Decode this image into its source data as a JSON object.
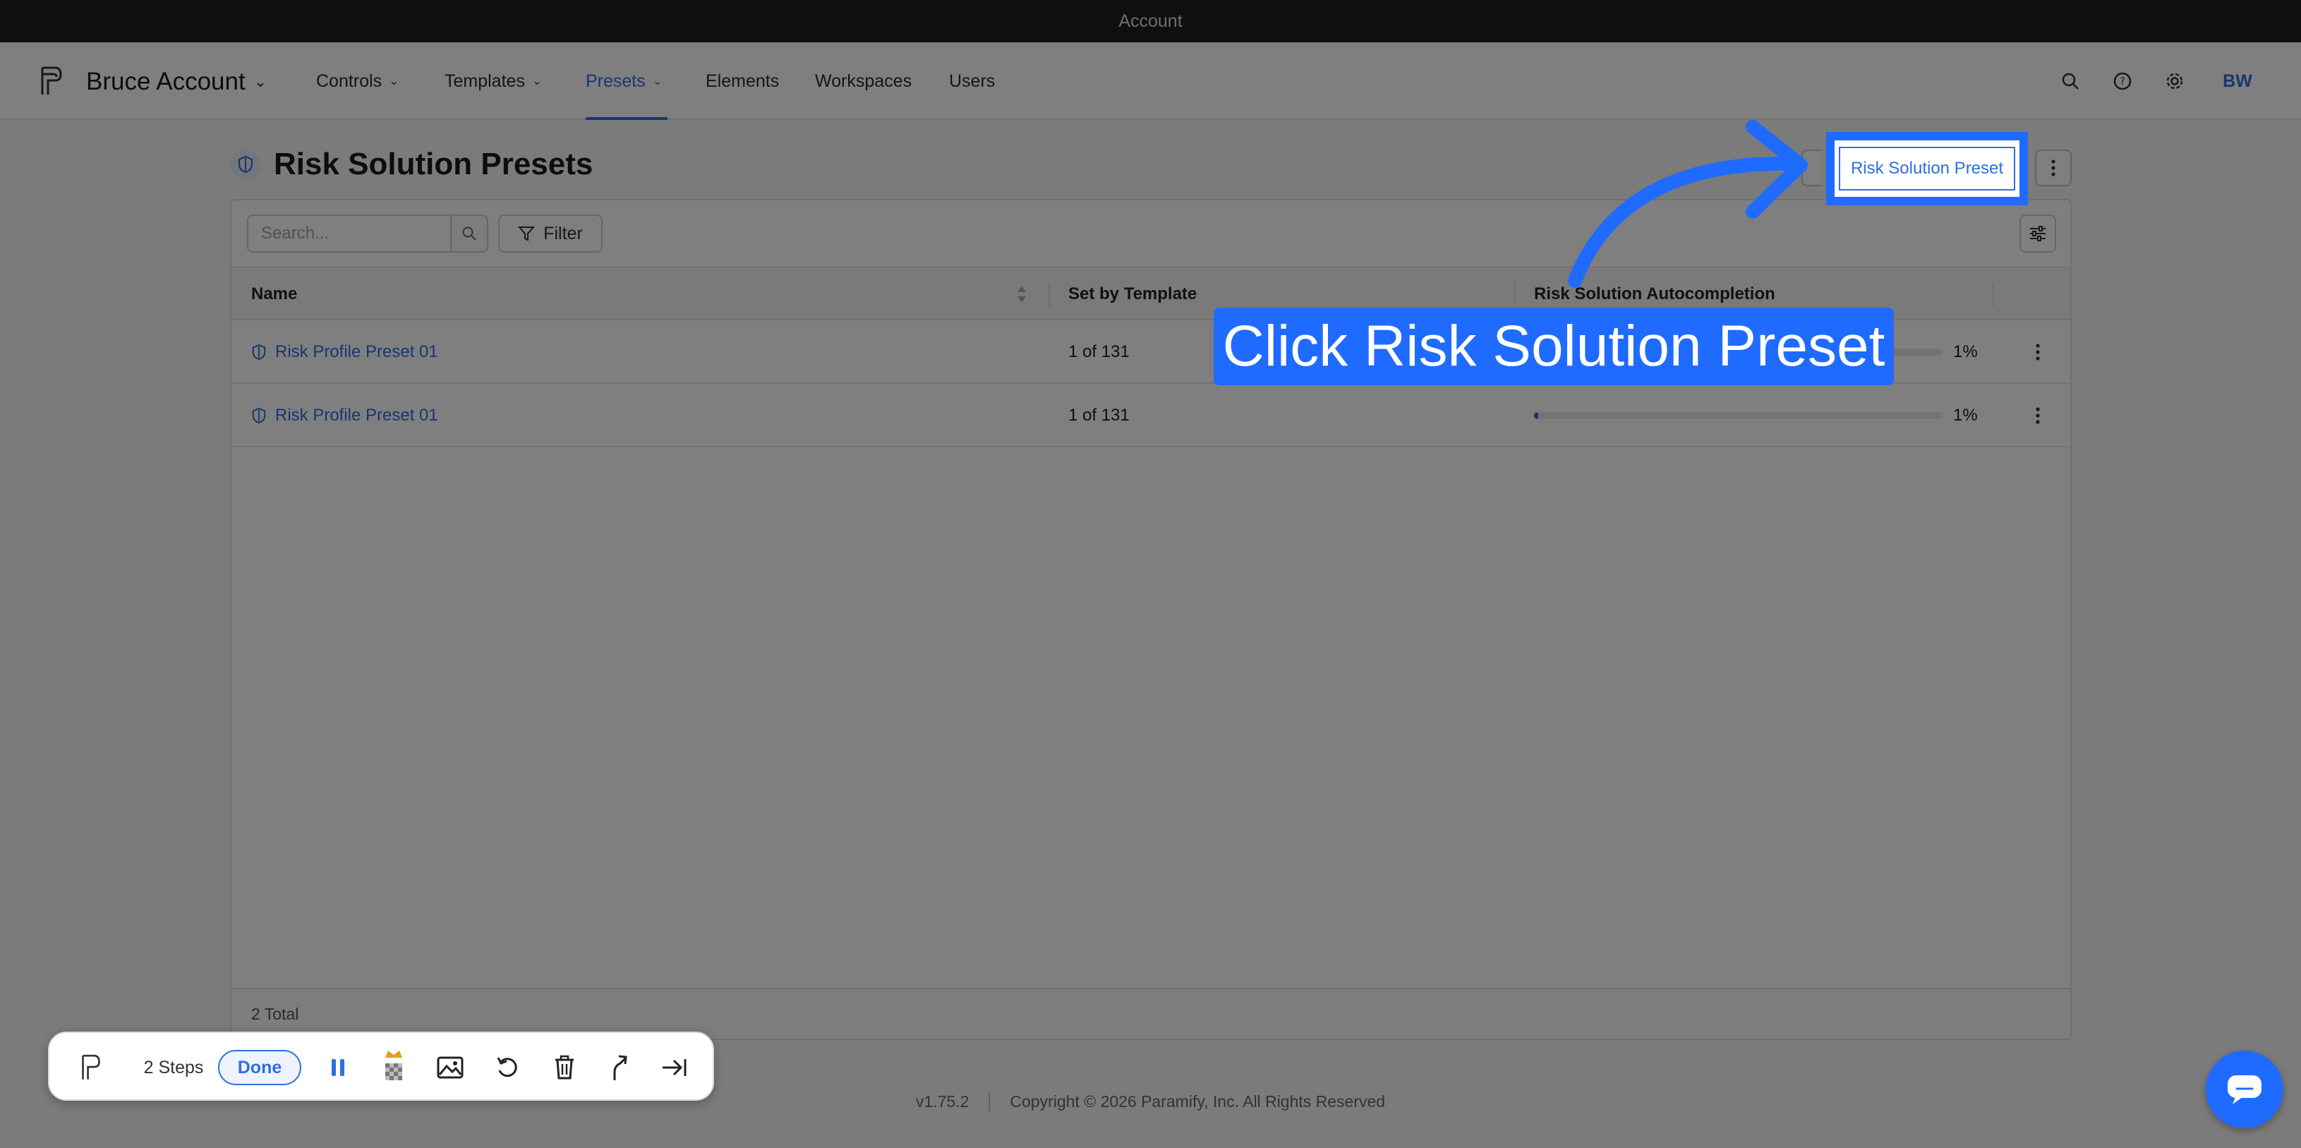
{
  "window": {
    "title": "Account"
  },
  "nav": {
    "account_name": "Bruce Account",
    "tabs": [
      {
        "label": "Controls"
      },
      {
        "label": "Templates"
      },
      {
        "label": "Presets"
      },
      {
        "label": "Elements"
      },
      {
        "label": "Workspaces"
      },
      {
        "label": "Users"
      }
    ],
    "active_tab": "Presets",
    "avatar_initials": "BW"
  },
  "page": {
    "title": "Risk Solution Presets",
    "primary_button_label": "Risk Solution Preset"
  },
  "toolbar": {
    "search_placeholder": "Search...",
    "filter_label": "Filter"
  },
  "table": {
    "columns": {
      "name": "Name",
      "set_by_template": "Set by Template",
      "autocompletion": "Risk Solution Autocompletion"
    },
    "rows": [
      {
        "name": "Risk Profile Preset 01",
        "set_by_template": "1 of 131",
        "autocompletion_pct": 1,
        "autocompletion_label": "1%"
      },
      {
        "name": "Risk Profile Preset 01",
        "set_by_template": "1 of 131",
        "autocompletion_pct": 1,
        "autocompletion_label": "1%"
      }
    ],
    "total_label": "2 Total"
  },
  "footer": {
    "version": "v1.75.2",
    "copyright": "Copyright © 2026 Paramify, Inc. All Rights Reserved"
  },
  "callout": {
    "text": "Click Risk Solution Preset"
  },
  "recorder": {
    "steps_label": "2 Steps",
    "done_label": "Done"
  },
  "colors": {
    "accent": "#2f6fe0",
    "highlight": "#1f6bff",
    "titlebar": "#1e1e1e"
  }
}
